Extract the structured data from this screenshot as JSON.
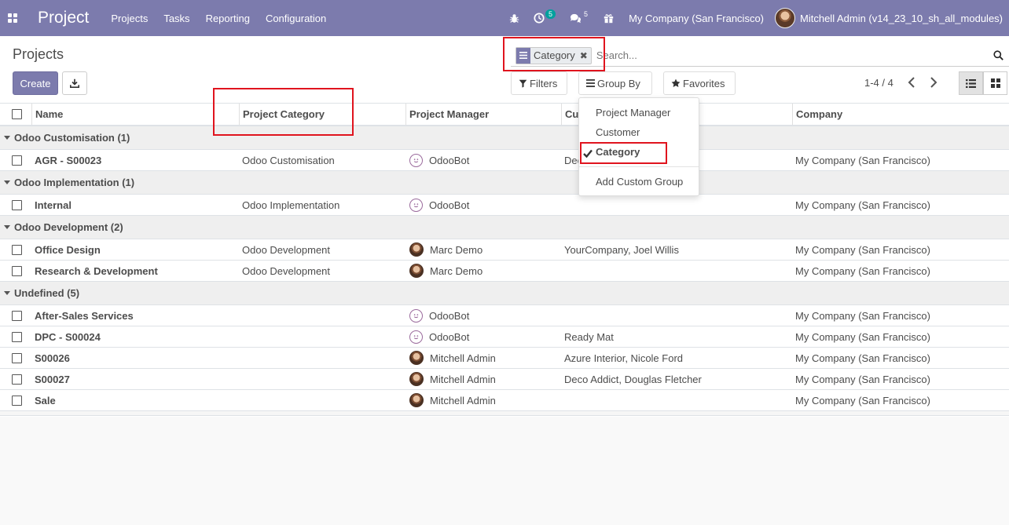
{
  "navbar": {
    "brand": "Project",
    "menu": [
      "Projects",
      "Tasks",
      "Reporting",
      "Configuration"
    ],
    "activity_count": "5",
    "messages_count": "5",
    "company": "My Company (San Francisco)",
    "user": "Mitchell Admin (v14_23_10_sh_all_modules)"
  },
  "control": {
    "title": "Projects",
    "create_label": "Create",
    "search": {
      "facet_label": "Category",
      "placeholder": "Search..."
    },
    "filters_label": "Filters",
    "groupby_label": "Group By",
    "favorites_label": "Favorites",
    "pager": "1-4 / 4"
  },
  "groupby_menu": {
    "items": [
      "Project Manager",
      "Customer",
      "Category"
    ],
    "selected": "Category",
    "custom_label": "Add Custom Group"
  },
  "table": {
    "headers": [
      "Name",
      "Project Category",
      "Project Manager",
      "Cu",
      "Company"
    ],
    "groups": [
      {
        "label": "Odoo Customisation (1)",
        "rows": [
          {
            "name": "AGR - S00023",
            "category": "Odoo Customisation",
            "manager": "OdooBot",
            "manager_avatar": "bot",
            "customer": "Dec",
            "company": "My Company (San Francisco)"
          }
        ]
      },
      {
        "label": "Odoo Implementation (1)",
        "rows": [
          {
            "name": "Internal",
            "category": "Odoo Implementation",
            "manager": "OdooBot",
            "manager_avatar": "bot",
            "customer": "",
            "company": "My Company (San Francisco)"
          }
        ]
      },
      {
        "label": "Odoo Development (2)",
        "rows": [
          {
            "name": "Office Design",
            "category": "Odoo Development",
            "manager": "Marc Demo",
            "manager_avatar": "person",
            "customer": "YourCompany, Joel Willis",
            "company": "My Company (San Francisco)"
          },
          {
            "name": "Research & Development",
            "category": "Odoo Development",
            "manager": "Marc Demo",
            "manager_avatar": "person",
            "customer": "",
            "company": "My Company (San Francisco)"
          }
        ]
      },
      {
        "label": "Undefined (5)",
        "rows": [
          {
            "name": "After-Sales Services",
            "category": "",
            "manager": "OdooBot",
            "manager_avatar": "bot",
            "customer": "",
            "company": "My Company (San Francisco)"
          },
          {
            "name": "DPC - S00024",
            "category": "",
            "manager": "OdooBot",
            "manager_avatar": "bot",
            "customer": "Ready Mat",
            "company": "My Company (San Francisco)"
          },
          {
            "name": "S00026",
            "category": "",
            "manager": "Mitchell Admin",
            "manager_avatar": "person",
            "customer": "Azure Interior, Nicole Ford",
            "company": "My Company (San Francisco)"
          },
          {
            "name": "S00027",
            "category": "",
            "manager": "Mitchell Admin",
            "manager_avatar": "person",
            "customer": "Deco Addict, Douglas Fletcher",
            "company": "My Company (San Francisco)"
          },
          {
            "name": "Sale",
            "category": "",
            "manager": "Mitchell Admin",
            "manager_avatar": "person",
            "customer": "",
            "company": "My Company (San Francisco)"
          }
        ]
      }
    ]
  },
  "colors": {
    "brand": "#7c7bad",
    "highlight": "#e0141e",
    "badge": "#00a09d"
  }
}
